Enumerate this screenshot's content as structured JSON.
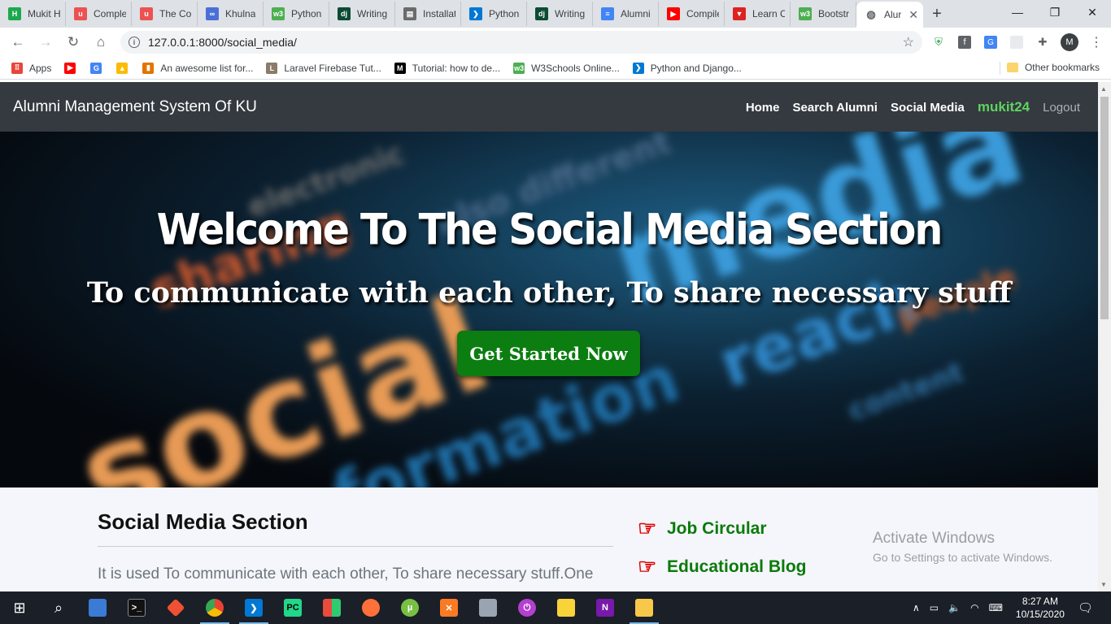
{
  "browser": {
    "tabs": [
      {
        "label": "Mukit H",
        "icon": "hackerrank-icon",
        "color": "#1ba94c",
        "glyph": "H"
      },
      {
        "label": "Comple",
        "icon": "udemy-icon",
        "color": "#ec5252",
        "glyph": "u"
      },
      {
        "label": "The Cor",
        "icon": "udemy-icon",
        "color": "#ec5252",
        "glyph": "u"
      },
      {
        "label": "Khulna",
        "icon": "infinity-icon",
        "color": "#4a6fd8",
        "glyph": "∞"
      },
      {
        "label": "Python",
        "icon": "w3schools-icon",
        "color": "#4caf50",
        "glyph": "w3"
      },
      {
        "label": "Writing",
        "icon": "django-icon",
        "color": "#0c4b33",
        "glyph": "dj"
      },
      {
        "label": "Installat",
        "icon": "document-icon",
        "color": "#6b6b6b",
        "glyph": "▤"
      },
      {
        "label": "Python",
        "icon": "vscode-icon",
        "color": "#0078d4",
        "glyph": "❯"
      },
      {
        "label": "Writing",
        "icon": "django-icon",
        "color": "#0c4b33",
        "glyph": "dj"
      },
      {
        "label": "Alumni",
        "icon": "docs-icon",
        "color": "#4285f4",
        "glyph": "≡"
      },
      {
        "label": "Compile",
        "icon": "youtube-icon",
        "color": "#ff0000",
        "glyph": "▶"
      },
      {
        "label": "Learn C",
        "icon": "vivaldi-icon",
        "color": "#d22",
        "glyph": "▼"
      },
      {
        "label": "Bootstr",
        "icon": "w3schools-icon",
        "color": "#4caf50",
        "glyph": "w3"
      }
    ],
    "active_tab": {
      "label": "Alur",
      "icon": "globe-icon"
    },
    "url": "127.0.0.1:8000/social_media/",
    "profile_initial": "M"
  },
  "bookmarks": {
    "items": [
      {
        "label": "Apps",
        "icon": "apps-grid-icon",
        "color": "#e8453c",
        "glyph": "⠿"
      },
      {
        "label": "",
        "icon": "youtube-icon",
        "color": "#ff0000",
        "glyph": "▶"
      },
      {
        "label": "",
        "icon": "google-translate-icon",
        "color": "#4285f4",
        "glyph": "G"
      },
      {
        "label": "",
        "icon": "google-drive-icon",
        "color": "#fbbc04",
        "glyph": "▲"
      },
      {
        "label": "An awesome list for...",
        "icon": "chart-bars-icon",
        "color": "#e37400",
        "glyph": "▮"
      },
      {
        "label": "Laravel Firebase Tut...",
        "icon": "laravel-icon",
        "color": "#8a7b6a",
        "glyph": "L"
      },
      {
        "label": "Tutorial: how to de...",
        "icon": "medium-icon",
        "color": "#000000",
        "glyph": "M"
      },
      {
        "label": "W3Schools Online...",
        "icon": "w3schools-icon",
        "color": "#4caf50",
        "glyph": "w3"
      },
      {
        "label": "Python and Django...",
        "icon": "vscode-icon",
        "color": "#0078d4",
        "glyph": "❯"
      }
    ],
    "other": "Other bookmarks"
  },
  "navbar": {
    "brand": "Alumni Management System Of KU",
    "links": [
      "Home",
      "Search Alumni",
      "Social Media"
    ],
    "user": "mukit24",
    "logout": "Logout"
  },
  "hero": {
    "title": "Welcome To The Social Media Section",
    "subtitle": "To communicate with each other, To share necessary stuff",
    "cta": "Get Started Now"
  },
  "section": {
    "title": "Social Media Section",
    "text": "It is used To communicate with each other, To share necessary stuff.One"
  },
  "sidebar_links": [
    "Job Circular",
    "Educational Blog"
  ],
  "watermark": {
    "line1": "Activate Windows",
    "line2": "Go to Settings to activate Windows."
  },
  "taskbar": {
    "time": "8:27 AM",
    "date": "10/15/2020"
  }
}
